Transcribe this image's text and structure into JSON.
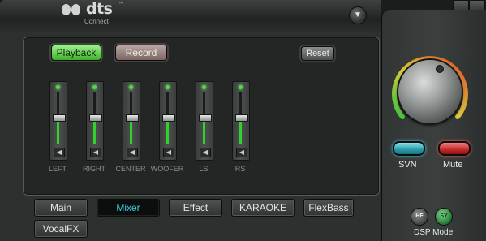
{
  "header": {
    "logo_text": "dts",
    "logo_tm": "™",
    "logo_sub": "Connect",
    "menu_icon": "chevron-down-icon"
  },
  "mixer": {
    "playback_label": "Playback",
    "record_label": "Record",
    "reset_label": "Reset",
    "channels": [
      {
        "label": "LEFT",
        "level": 0.4
      },
      {
        "label": "RIGHT",
        "level": 0.4
      },
      {
        "label": "CENTER",
        "level": 0.4
      },
      {
        "label": "WOOFER",
        "level": 0.4
      },
      {
        "label": "LS",
        "level": 0.4
      },
      {
        "label": "RS",
        "level": 0.4
      }
    ]
  },
  "tabs": [
    {
      "label": "Main",
      "active": false
    },
    {
      "label": "Mixer",
      "active": true
    },
    {
      "label": "Effect",
      "active": false
    },
    {
      "label": "KARAOKE",
      "active": false
    },
    {
      "label": "FlexBass",
      "active": false
    },
    {
      "label": "VocalFX",
      "active": false
    }
  ],
  "right": {
    "svn_label": "SVN",
    "mute_label": "Mute",
    "dsp_mode_label": "DSP Mode",
    "dsp_hf": "HF",
    "dsp_sy": "SY"
  },
  "colors": {
    "accent_green": "#31d22a",
    "accent_cyan": "#39d0e0",
    "mute_red": "#c42a2a"
  }
}
